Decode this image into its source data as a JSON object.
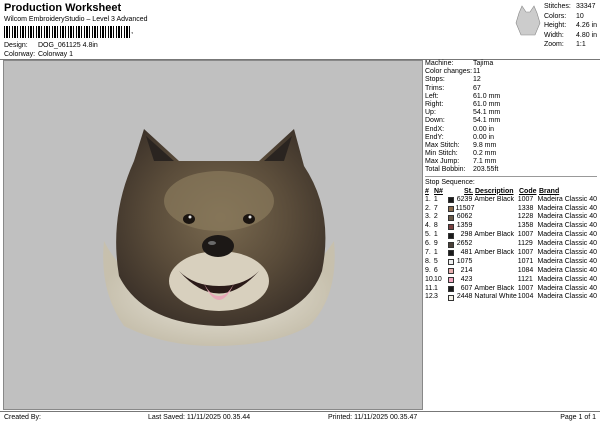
{
  "header": {
    "title": "Production Worksheet",
    "subtitle": "Wilcom EmbroideryStudio – Level 3 Advanced",
    "barcode_suffix": ",",
    "design_label": "Design:",
    "design_value": "DOG_061125 4.8in",
    "colorway_label": "Colorway:",
    "colorway_value": "Colorway 1"
  },
  "stats": {
    "stitches_label": "Stitches:",
    "stitches": "33347",
    "colors_label": "Colors:",
    "colors": "10",
    "height_label": "Height:",
    "height": "4.26 in",
    "width_label": "Width:",
    "width": "4.80 in",
    "zoom_label": "Zoom:",
    "zoom": "1:1"
  },
  "machine_info": [
    {
      "label": "Machine:",
      "value": "Tajima"
    },
    {
      "label": "Color changes:",
      "value": "11"
    },
    {
      "label": "Stops:",
      "value": "12"
    },
    {
      "label": "Trims:",
      "value": "67"
    },
    {
      "label": "Left:",
      "value": "61.0 mm"
    },
    {
      "label": "Right:",
      "value": "61.0 mm"
    },
    {
      "label": "Up:",
      "value": "54.1 mm"
    },
    {
      "label": "Down:",
      "value": "54.1 mm"
    },
    {
      "label": "EndX:",
      "value": "0.00 in"
    },
    {
      "label": "EndY:",
      "value": "0.00 in"
    },
    {
      "label": "Max Stitch:",
      "value": "9.8 mm"
    },
    {
      "label": "Min Stitch:",
      "value": "0.2 mm"
    },
    {
      "label": "Max Jump:",
      "value": "7.1 mm"
    },
    {
      "label": "Total Bobbin:",
      "value": "203.55ft"
    }
  ],
  "stop_sequence": {
    "title": "Stop Sequence:",
    "headers": {
      "num": "#",
      "nc": "N#",
      "st": "St.",
      "desc": "Description",
      "code": "Code",
      "brand": "Brand"
    },
    "rows": [
      {
        "num": "1.",
        "nc": "1",
        "color": "#1a1a1a",
        "st": "6239",
        "desc": "Amber Black",
        "code": "1007",
        "brand": "Madeira Classic 40"
      },
      {
        "num": "2.",
        "nc": "7",
        "color": "#8a6a4a",
        "st": "11507",
        "desc": "",
        "code": "1338",
        "brand": "Madeira Classic 40"
      },
      {
        "num": "3.",
        "nc": "2",
        "color": "#6a5a48",
        "st": "6062",
        "desc": "",
        "code": "1228",
        "brand": "Madeira Classic 40"
      },
      {
        "num": "4.",
        "nc": "8",
        "color": "#7a4040",
        "st": "1359",
        "desc": "",
        "code": "1358",
        "brand": "Madeira Classic 40"
      },
      {
        "num": "5.",
        "nc": "1",
        "color": "#1a1a1a",
        "st": "298",
        "desc": "Amber Black",
        "code": "1007",
        "brand": "Madeira Classic 40"
      },
      {
        "num": "6.",
        "nc": "9",
        "color": "#4a4038",
        "st": "2652",
        "desc": "",
        "code": "1129",
        "brand": "Madeira Classic 40"
      },
      {
        "num": "7.",
        "nc": "1",
        "color": "#1a1a1a",
        "st": "481",
        "desc": "Amber Black",
        "code": "1007",
        "brand": "Madeira Classic 40"
      },
      {
        "num": "8.",
        "nc": "5",
        "color": "#f0f0f0",
        "st": "1075",
        "desc": "",
        "code": "1071",
        "brand": "Madeira Classic 40"
      },
      {
        "num": "9.",
        "nc": "6",
        "color": "#e8b0b0",
        "st": "214",
        "desc": "",
        "code": "1084",
        "brand": "Madeira Classic 40"
      },
      {
        "num": "10.",
        "nc": "10",
        "color": "#f0a8c0",
        "st": "423",
        "desc": "",
        "code": "1121",
        "brand": "Madeira Classic 40"
      },
      {
        "num": "11.",
        "nc": "1",
        "color": "#1a1a1a",
        "st": "607",
        "desc": "Amber Black",
        "code": "1007",
        "brand": "Madeira Classic 40"
      },
      {
        "num": "12.",
        "nc": "3",
        "color": "#f4f2e8",
        "st": "2448",
        "desc": "Natural White",
        "code": "1004",
        "brand": "Madeira Classic 40"
      }
    ]
  },
  "footer": {
    "created_by": "Created By:",
    "last_saved": "Last Saved: 11/11/2025 00.35.44",
    "printed": "Printed: 11/11/2025 00.35.47",
    "page": "Page 1 of 1"
  },
  "colors": {
    "canvas_bg": "#c0c0c0"
  }
}
